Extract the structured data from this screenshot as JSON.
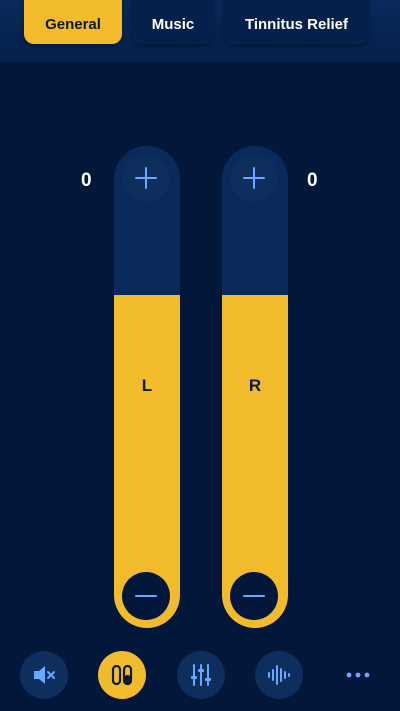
{
  "tabs": [
    {
      "label": "General",
      "active": true
    },
    {
      "label": "Music",
      "active": false
    },
    {
      "label": "Tinnitus Relief",
      "active": false
    }
  ],
  "volume": {
    "left": {
      "label": "L",
      "value": "0",
      "fill_percent": 69
    },
    "right": {
      "label": "R",
      "value": "0",
      "fill_percent": 69
    }
  },
  "icons": {
    "increase": "plus-icon",
    "decrease": "minus-icon",
    "mute": "speaker-mute-icon",
    "earbuds": "earbuds-icon",
    "equalizer": "equalizer-sliders-icon",
    "sound_wave": "sound-wave-icon",
    "more": "more-dots-icon"
  },
  "colors": {
    "accent": "#f2bb2b",
    "background": "#03173a",
    "panel": "#0a2a5c",
    "icon": "#6aa8ff"
  }
}
